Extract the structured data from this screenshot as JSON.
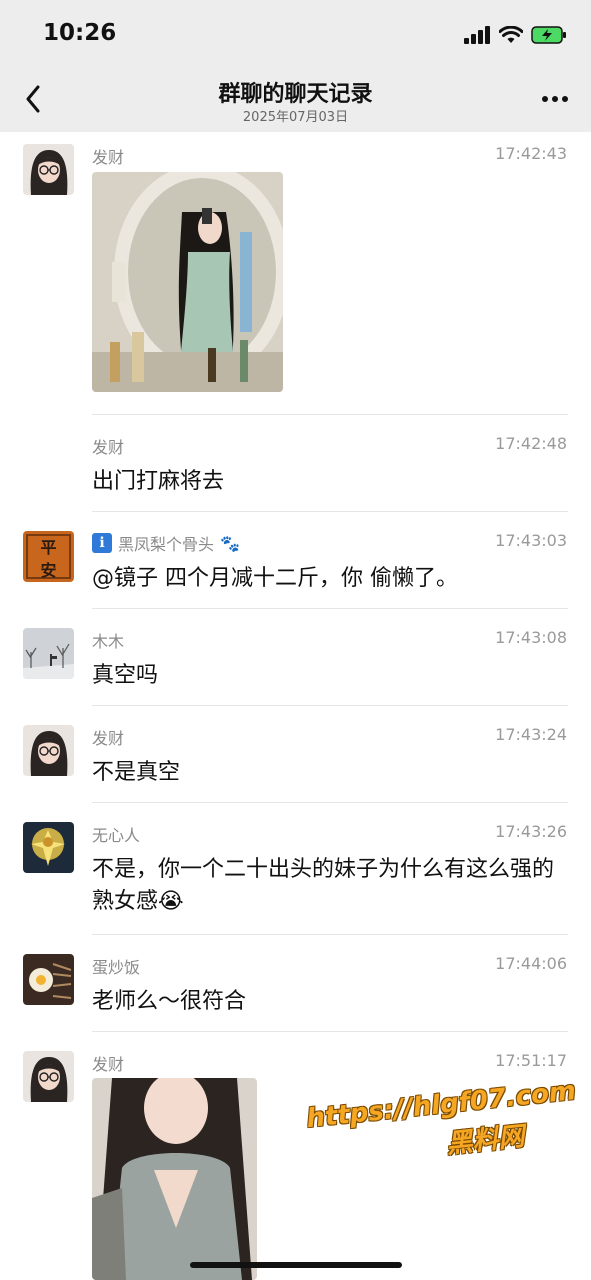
{
  "status": {
    "time": "10:26"
  },
  "header": {
    "title": "群聊的聊天记录",
    "subtitle": "2025年07月03日"
  },
  "messages": [
    {
      "sender": "发财",
      "time": "17:42:43",
      "type": "image"
    },
    {
      "sender": "发财",
      "time": "17:42:48",
      "text": "出门打麻将去"
    },
    {
      "sender": "黑凤梨个骨头",
      "sender_badge": "ℹ",
      "sender_suffix": "🐾",
      "time": "17:43:03",
      "text": "@镜子 四个月减十二斤，你 偷懒了。"
    },
    {
      "sender": "木木",
      "time": "17:43:08",
      "text": "真空吗"
    },
    {
      "sender": "发财",
      "time": "17:43:24",
      "text": "不是真空"
    },
    {
      "sender": "无心人",
      "time": "17:43:26",
      "text": "不是，你一个二十出头的妹子为什么有这么强的熟女感😭"
    },
    {
      "sender": "蛋炒饭",
      "time": "17:44:06",
      "text": "老师么～很符合"
    },
    {
      "sender": "发财",
      "time": "17:51:17",
      "type": "image"
    }
  ],
  "avatar_texts": {
    "pingan_top": "平",
    "pingan_bottom": "安"
  },
  "watermark": {
    "url": "https://hlgf07.com",
    "name": "黑料网"
  },
  "colors": {
    "background": "#ffffff",
    "header_bg": "#ededed",
    "watermark": "#f5a623"
  }
}
